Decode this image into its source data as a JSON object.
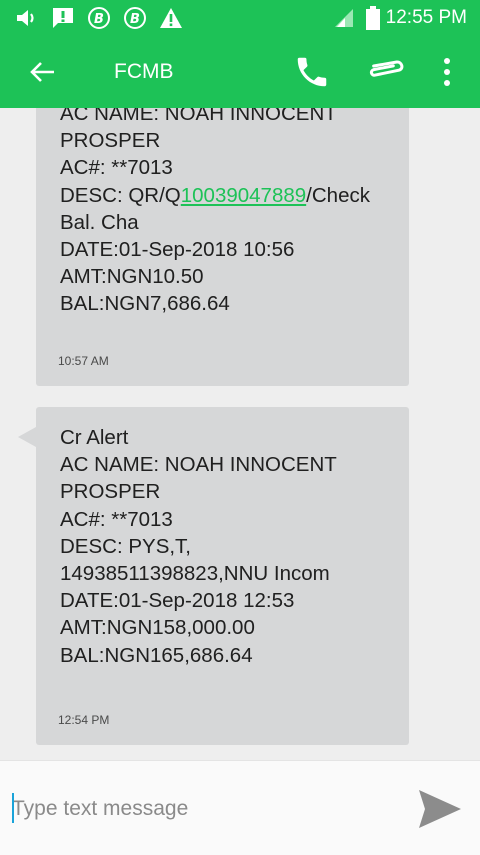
{
  "status_bar": {
    "time": "12:55 PM",
    "icons": [
      "volume-icon",
      "alert-message-icon",
      "bbm-icon",
      "bbm-icon",
      "warning-icon",
      "signal-icon",
      "battery-icon"
    ]
  },
  "app_bar": {
    "title": "FCMB",
    "icons": [
      "back-arrow-icon",
      "phone-icon",
      "attachment-icon",
      "more-vertical-icon"
    ]
  },
  "messages": [
    {
      "lines": [
        "AC NAME: NOAH INNOCENT",
        "PROSPER",
        "AC#: **7013"
      ],
      "desc_prefix": "DESC: QR/Q",
      "desc_link": "10039047889",
      "desc_suffix": "/Check",
      "lines_after": [
        "Bal. Cha",
        "DATE:01-Sep-2018 10:56",
        "AMT:NGN10.50",
        "BAL:NGN7,686.64"
      ],
      "time": "10:57 AM"
    },
    {
      "text": "Cr Alert\nAC NAME: NOAH INNOCENT\nPROSPER\nAC#: **7013\nDESC: PYS,T,\n14938511398823,NNU Incom\nDATE:01-Sep-2018 12:53\nAMT:NGN158,000.00\nBAL:NGN165,686.64",
      "time": "12:54 PM"
    }
  ],
  "compose": {
    "placeholder": "Type text message",
    "value": "",
    "send_icon": "send-icon"
  },
  "colors": {
    "accent": "#1dc257",
    "bubble": "#d6d7d8",
    "background": "#eeeeee"
  }
}
